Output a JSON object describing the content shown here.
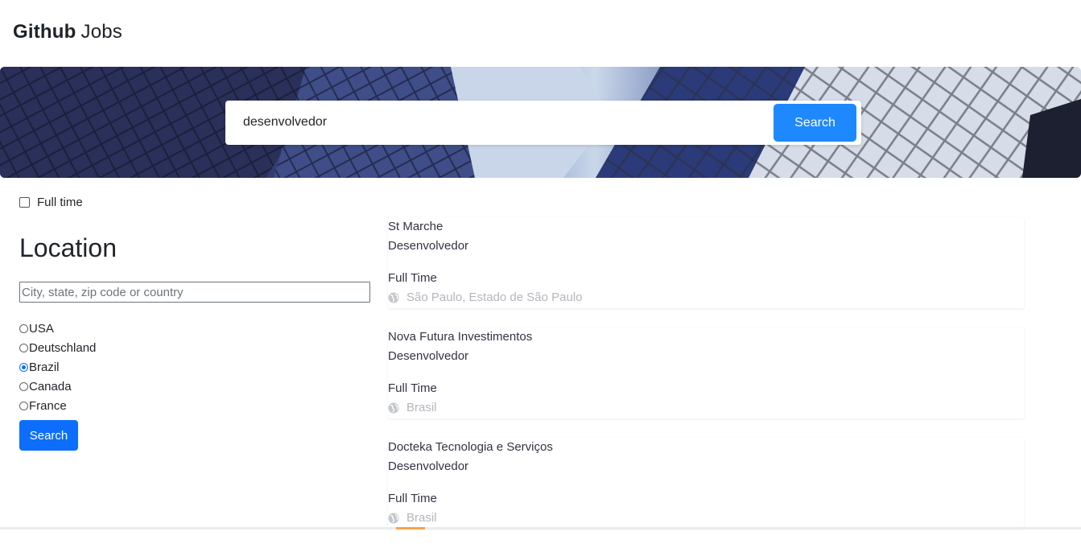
{
  "header": {
    "logo_bold": "Github",
    "logo_light": "Jobs"
  },
  "hero": {
    "search_value": "desenvolvedor",
    "search_button": "Search"
  },
  "filters": {
    "full_time_label": "Full time",
    "full_time_checked": false,
    "location_title": "Location",
    "location_placeholder": "City, state, zip code or country",
    "options": [
      {
        "label": "USA",
        "checked": false
      },
      {
        "label": "Deutschland",
        "checked": false
      },
      {
        "label": "Brazil",
        "checked": true
      },
      {
        "label": "Canada",
        "checked": false
      },
      {
        "label": "France",
        "checked": false
      }
    ],
    "search_button": "Search"
  },
  "jobs": [
    {
      "company": "St Marche",
      "title": "Desenvolvedor",
      "type": "Full Time",
      "location": "São Paulo, Estado de São Paulo",
      "icon": "globe-icon"
    },
    {
      "company": "Nova Futura Investimentos",
      "title": "Desenvolvedor",
      "type": "Full Time",
      "location": "Brasil",
      "icon": "globe-icon"
    },
    {
      "company": "Docteka Tecnologia e Serviços",
      "title": "Desenvolvedor",
      "type": "Full Time",
      "location": "Brasil",
      "icon": "globe-icon"
    }
  ],
  "colors": {
    "primary": "#0d6efd",
    "hero_button": "#1e88ff",
    "muted": "#b3b6bd"
  }
}
